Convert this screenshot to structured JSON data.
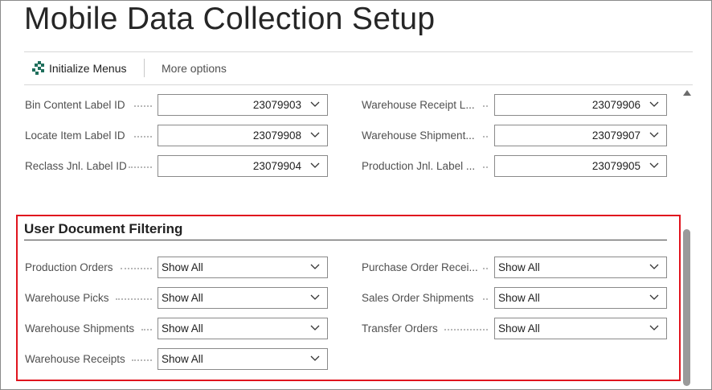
{
  "page": {
    "title": "Mobile Data Collection Setup"
  },
  "actions": {
    "initialize_menus": "Initialize Menus",
    "more_options": "More options"
  },
  "label_fields": [
    {
      "label": "Bin Content Label ID",
      "value": "23079903"
    },
    {
      "label": "Locate Item Label ID",
      "value": "23079908"
    },
    {
      "label": "Reclass Jnl. Label ID",
      "value": "23079904"
    },
    {
      "label": "Warehouse Receipt L...",
      "value": "23079906"
    },
    {
      "label": "Warehouse Shipment...",
      "value": "23079907"
    },
    {
      "label": "Production Jnl. Label ...",
      "value": "23079905"
    }
  ],
  "filtering": {
    "title": "User Document Filtering",
    "fields": [
      {
        "label": "Production Orders",
        "value": "Show All"
      },
      {
        "label": "Warehouse Picks",
        "value": "Show All"
      },
      {
        "label": "Warehouse Shipments",
        "value": "Show All"
      },
      {
        "label": "Warehouse Receipts",
        "value": "Show All"
      },
      {
        "label": "Purchase Order Recei...",
        "value": "Show All"
      },
      {
        "label": "Sales Order Shipments",
        "value": "Show All"
      },
      {
        "label": "Transfer Orders",
        "value": "Show All"
      }
    ]
  },
  "colors": {
    "highlight": "#e0141e",
    "icon": "#1f6f5c"
  }
}
